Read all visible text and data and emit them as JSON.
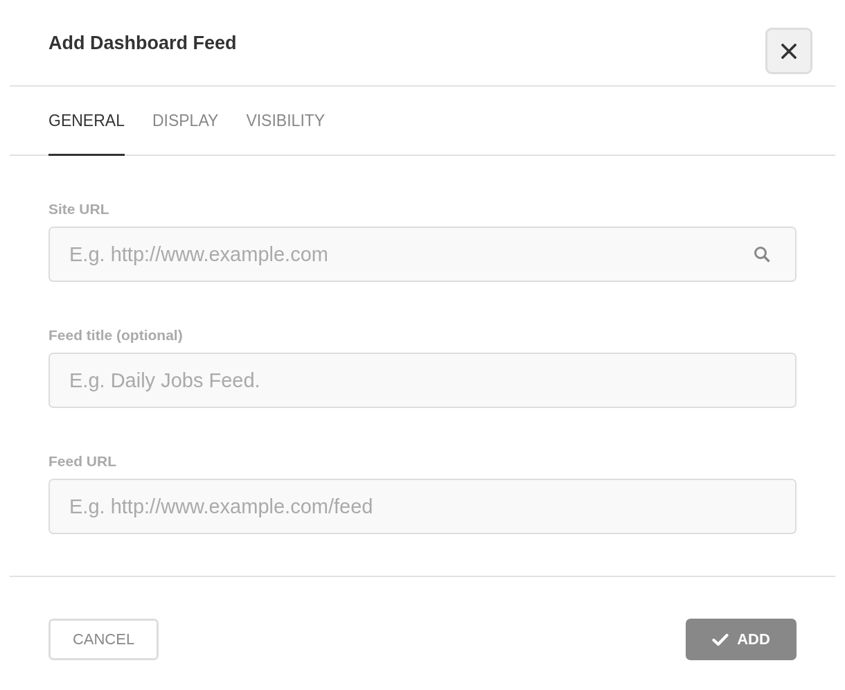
{
  "dialog": {
    "title": "Add Dashboard Feed"
  },
  "tabs": [
    {
      "label": "GENERAL",
      "selected": true
    },
    {
      "label": "DISPLAY",
      "selected": false
    },
    {
      "label": "VISIBILITY",
      "selected": false
    }
  ],
  "fields": [
    {
      "kind": "search",
      "label": "Site URL",
      "placeholder": "E.g. http://www.example.com"
    },
    {
      "kind": "text",
      "label": "Feed title (optional)",
      "placeholder": "E.g. Daily Jobs Feed."
    },
    {
      "kind": "text",
      "label": "Feed URL",
      "placeholder": "E.g. http://www.example.com/feed"
    }
  ],
  "buttons": [
    {
      "kind": "secondary",
      "label": "CANCEL"
    },
    {
      "kind": "primary",
      "label": "ADD"
    }
  ]
}
